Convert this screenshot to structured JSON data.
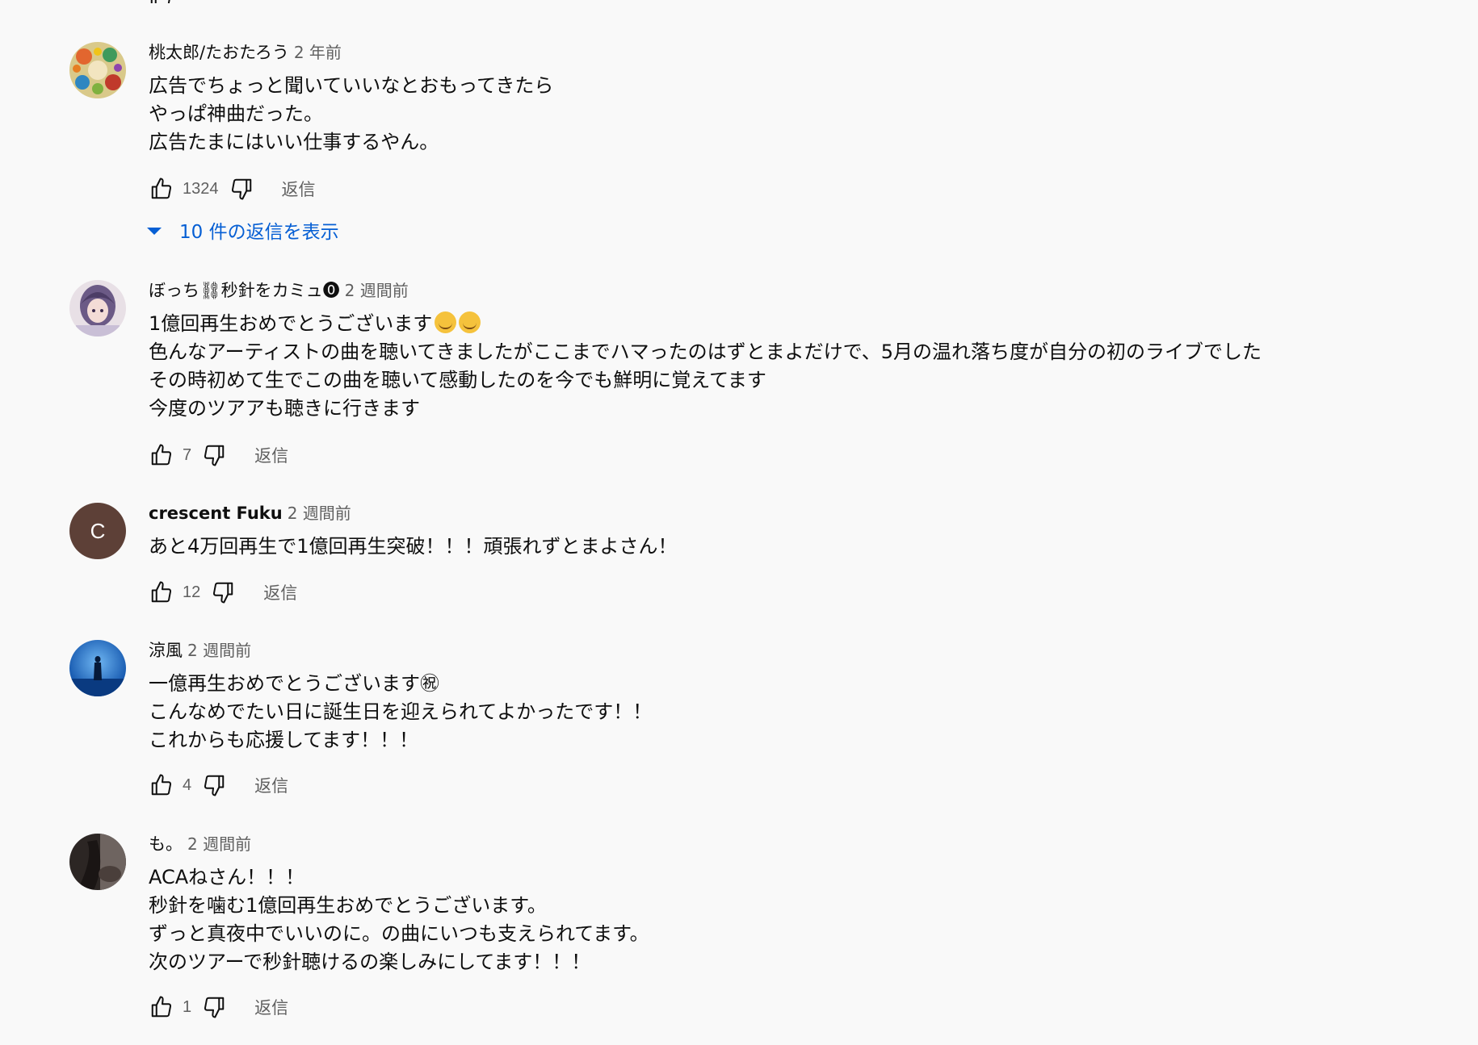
{
  "labels": {
    "reply": "返信"
  },
  "partial_top_text": "...",
  "comments": [
    {
      "author": "桃太郎/たおたろう",
      "time": "2 年前",
      "lines": [
        "広告でちょっと聞いていいなとおもってきたら",
        "やっぱ神曲だった。",
        "広告たまにはいい仕事するやん。"
      ],
      "likes": "1324",
      "replies_label": "10 件の返信を表示",
      "avatar": {
        "icon": "colorful-illustration-avatar"
      }
    },
    {
      "author": "ぼっち⛓秒針をカミュ⓿",
      "time": "2 週間前",
      "lines": [
        "1億回再生おめでとうございます",
        "色んなアーティストの曲を聴いてきましたがここまでハマったのはずとまよだけで、5月の温れ落ち度が自分の初のライブでした",
        "その時初めて生でこの曲を聴いて感動したのを今でも鮮明に覚えてます",
        "今度のツアアも聴きに行きます"
      ],
      "emoji": [
        "smiling-face-with-hearts-emoji",
        "smiling-face-with-hearts-emoji"
      ],
      "likes": "7",
      "avatar": {
        "icon": "anime-character-avatar"
      }
    },
    {
      "author": "crescent Fuku",
      "time": "2 週間前",
      "lines": [
        "あと4万回再生で1億回再生突破！！！頑張れずとまよさん！"
      ],
      "likes": "12",
      "avatar": {
        "letter": "C",
        "color": "#5d4037"
      }
    },
    {
      "author": "涼風",
      "time": "2 週間前",
      "lines": [
        "一億再生おめでとうございます㊗",
        "こんなめでたい日に誕生日を迎えられてよかったです！！",
        "これからも応援してます！！！"
      ],
      "likes": "4",
      "avatar": {
        "icon": "blue-sky-silhouette-avatar"
      }
    },
    {
      "author": "も。",
      "time": "2 週間前",
      "lines": [
        "ACAねさん！！！",
        "秒針を噛む1億回再生おめでとうございます。",
        "ずっと真夜中でいいのに。の曲にいつも支えられてます。",
        "次のツアーで秒針聴けるの楽しみにしてます！！！"
      ],
      "likes": "1",
      "avatar": {
        "icon": "dark-photo-avatar"
      }
    }
  ],
  "colors": {
    "background": "#f9f9f9",
    "text": "#0f0f0f",
    "secondary_text": "#606060",
    "link_blue": "#065fd4"
  }
}
